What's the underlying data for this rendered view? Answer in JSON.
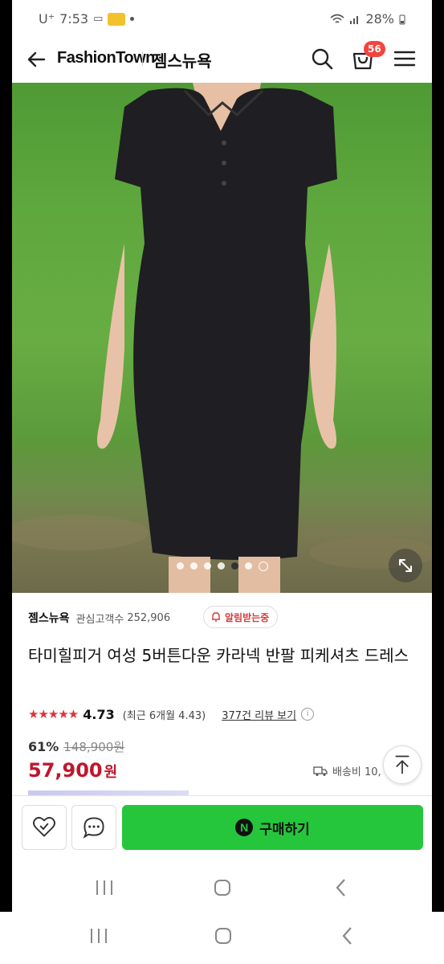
{
  "status_bar": {
    "carrier": "U⁺",
    "time": "7:53",
    "battery": "28%"
  },
  "header": {
    "brand": "FashionTown",
    "store": "젬스뉴욕",
    "cart_count": "56"
  },
  "gallery": {
    "image_count": 6,
    "active_index": 4
  },
  "seller": {
    "name": "젬스뉴욕",
    "followers_label": "관심고객수",
    "followers": "252,906",
    "alert_label": "알림받는중"
  },
  "product": {
    "title": "타미힐피거 여성 5버튼다운 카라넥 반팔 피케셔츠 드레스",
    "rating": "4.73",
    "rating_recent": "(최근 6개월 4.43)",
    "review_link": "377건 리뷰 보기",
    "discount": "61%",
    "original_price": "148,900원",
    "price": "57,900",
    "currency": "원",
    "shipping": "배송비 10,"
  },
  "actions": {
    "buy_label": "구매하기",
    "npay_letter": "N"
  },
  "colors": {
    "buy_green": "#25c63c",
    "price_red": "#c0162d",
    "badge_red": "#f2453d",
    "star_red": "#e0333a"
  }
}
